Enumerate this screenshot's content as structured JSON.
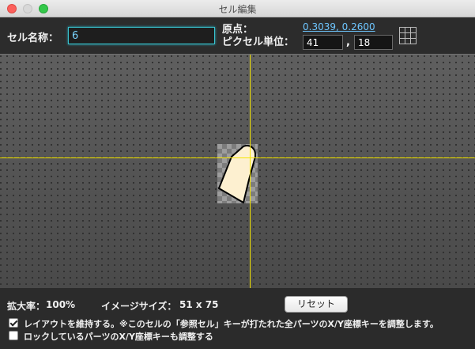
{
  "window": {
    "title": "セル編集"
  },
  "header": {
    "name_label": "セル名称：",
    "name_value": "6",
    "origin_label": "原点：",
    "origin_value": "0.3039, 0.2600",
    "pixel_unit_label": "ピクセル単位：",
    "pixel_x": "41",
    "pixel_y": "18",
    "comma": ",",
    "grid_icon": "grid-icon"
  },
  "footer": {
    "zoom_label": "拡大率：",
    "zoom_value": "100%",
    "image_size_label": "イメージサイズ：",
    "image_size_value": "51 x 75",
    "reset_label": "リセット",
    "keep_layout_label": "レイアウトを維持する。※このセルの「参照セル」キーが打たれた全パーツのX/Y座標キーを調整します。",
    "keep_layout_checked": true,
    "lock_parts_label": "ロックしているパーツのX/Y座標キーも調整する",
    "lock_parts_checked": false
  },
  "colors": {
    "crosshair": "#f5e600",
    "link": "#6ec6ff",
    "input_focus": "#39c3cf",
    "cell_fill": "#fdf0d0"
  }
}
